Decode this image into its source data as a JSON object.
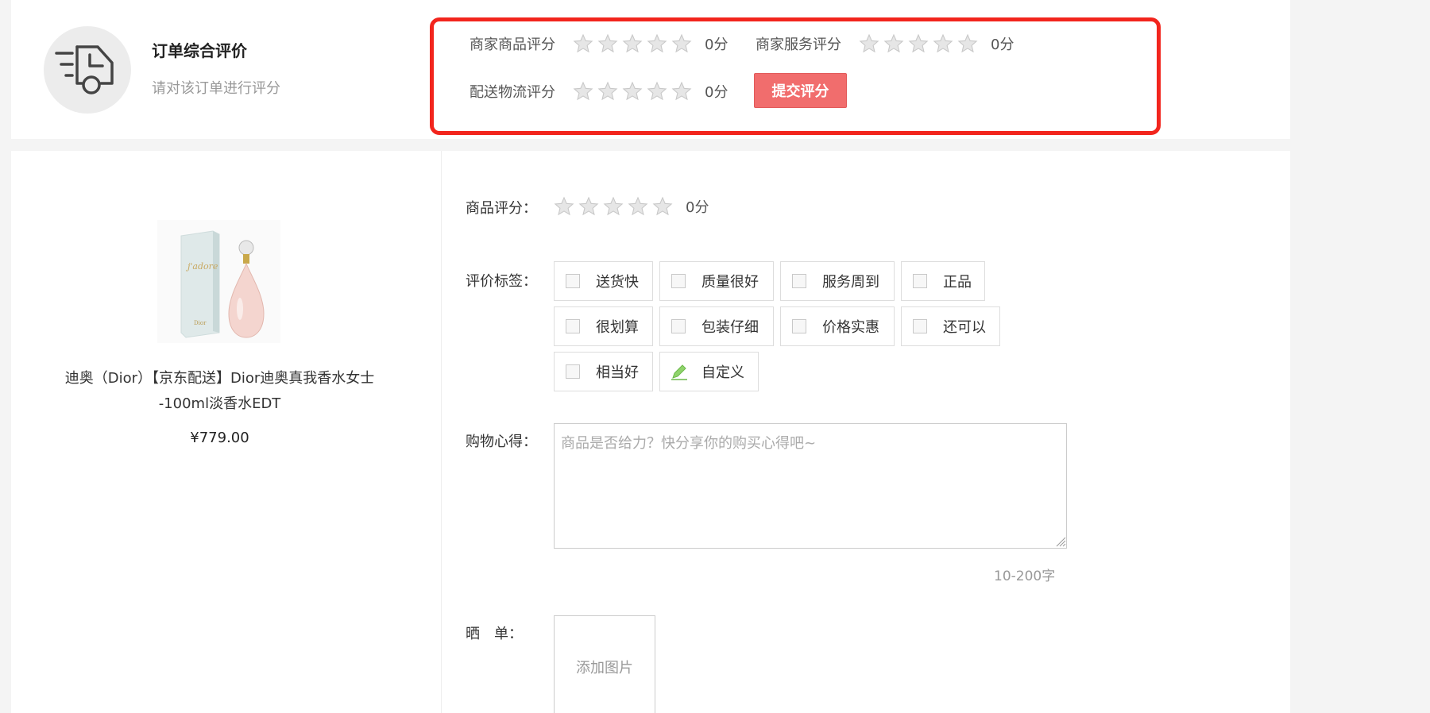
{
  "order": {
    "title": "订单综合评价",
    "subtitle": "请对该订单进行评分",
    "icon": "delivery-truck-icon"
  },
  "ratings": {
    "goods": {
      "label": "商家商品评分",
      "value": 0,
      "max": 5,
      "score_text": "0分"
    },
    "service": {
      "label": "商家服务评分",
      "value": 0,
      "max": 5,
      "score_text": "0分"
    },
    "logistics": {
      "label": "配送物流评分",
      "value": 0,
      "max": 5,
      "score_text": "0分"
    },
    "submit_label": "提交评分"
  },
  "product": {
    "name": "迪奥（Dior）【京东配送】Dior迪奥真我香水女士 -100ml淡香水EDT",
    "price": "¥779.00",
    "image_icon": "perfume-bottle-icon",
    "rating": {
      "label": "商品评分：",
      "value": 0,
      "max": 5,
      "score_text": "0分"
    }
  },
  "tags": {
    "label": "评价标签：",
    "items": [
      "送货快",
      "质量很好",
      "服务周到",
      "正品",
      "很划算",
      "包装仔细",
      "价格实惠",
      "还可以",
      "相当好"
    ],
    "custom_label": "自定义"
  },
  "review": {
    "label": "购物心得：",
    "placeholder": "商品是否给力？快分享你的购买心得吧~",
    "value": "",
    "count_hint": "10-200字"
  },
  "photos": {
    "label": "晒　单：",
    "add_label": "添加图片"
  },
  "colors": {
    "accent": "#f16d6d",
    "highlight_border": "#f2251d",
    "star_empty": "#d9d9d9"
  }
}
